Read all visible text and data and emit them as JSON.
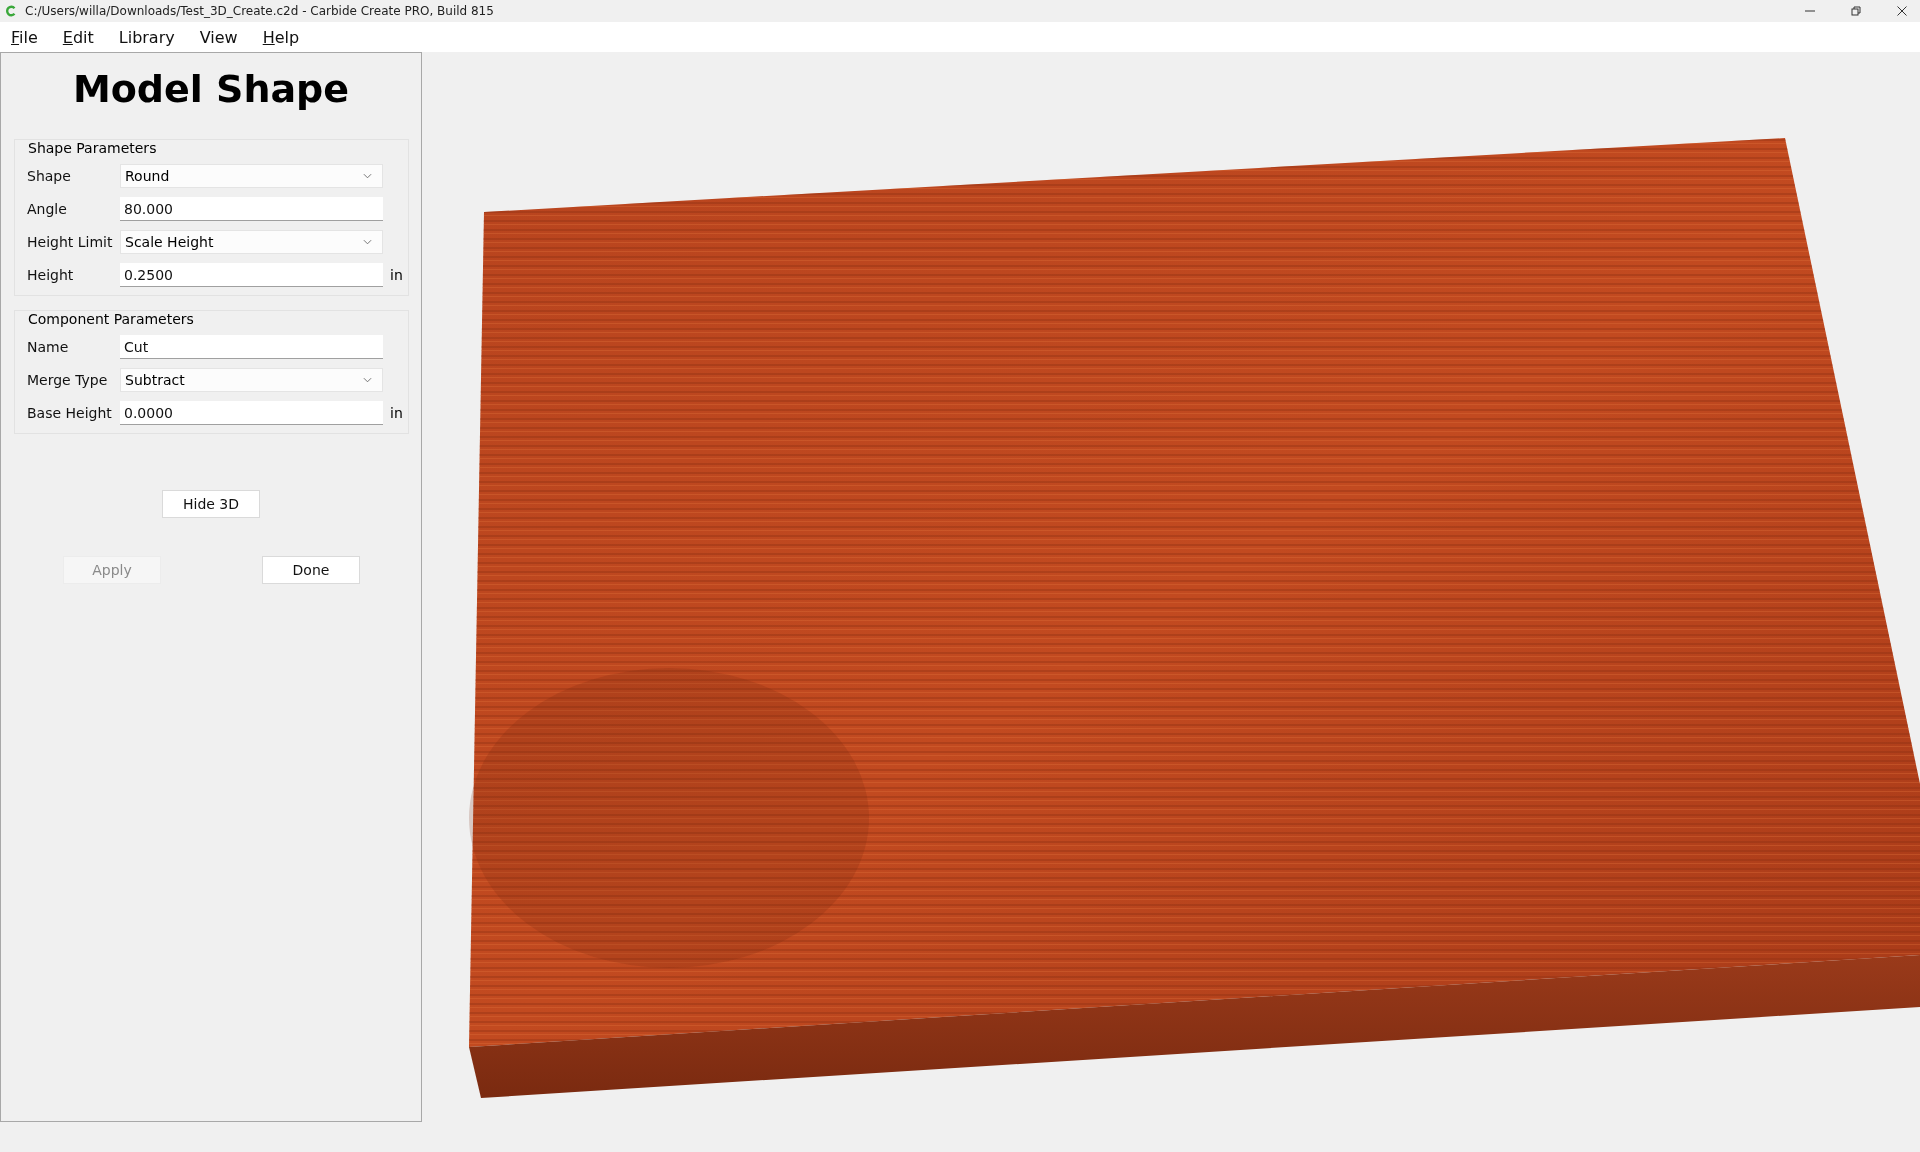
{
  "window": {
    "title": "C:/Users/willa/Downloads/Test_3D_Create.c2d - Carbide Create PRO, Build 815"
  },
  "menu": [
    {
      "label": "File",
      "underline_first": true
    },
    {
      "label": "Edit",
      "underline_first": true
    },
    {
      "label": "Library",
      "underline_first": false
    },
    {
      "label": "View",
      "underline_first": false
    },
    {
      "label": "Help",
      "underline_first": true
    }
  ],
  "panel": {
    "heading": "Model Shape",
    "groups": [
      {
        "title": "Shape Parameters",
        "fields": [
          {
            "label": "Shape",
            "kind": "dropdown",
            "value": "Round"
          },
          {
            "label": "Angle",
            "kind": "text",
            "value": "80.000"
          },
          {
            "label": "Height Limit",
            "kind": "dropdown",
            "value": "Scale Height"
          },
          {
            "label": "Height",
            "kind": "text",
            "value": "0.2500",
            "unit": "in"
          }
        ]
      },
      {
        "title": "Component Parameters",
        "fields": [
          {
            "label": "Name",
            "kind": "text",
            "value": "Cut"
          },
          {
            "label": "Merge Type",
            "kind": "dropdown",
            "value": "Subtract"
          },
          {
            "label": "Base Height",
            "kind": "text",
            "value": "0.0000",
            "unit": "in"
          }
        ]
      }
    ],
    "toggle_button": {
      "label": "Hide 3D",
      "disabled": false
    },
    "actions": [
      {
        "label": "Apply",
        "disabled": true
      },
      {
        "label": "Done",
        "disabled": false
      }
    ]
  }
}
